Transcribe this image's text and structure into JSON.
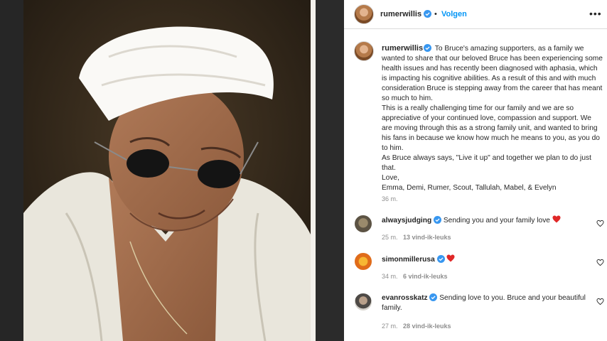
{
  "post": {
    "author": "rumerwillis",
    "follow_label": "Volgen",
    "more_label": "•••",
    "separator": "•",
    "caption_lines": [
      "To Bruce's amazing supporters, as a family we wanted to share that our beloved Bruce has been experiencing some health issues and has recently been diagnosed with aphasia, which is impacting his cognitive abilities. As a result of this and with much consideration Bruce is stepping away from the career that has meant so much to him.",
      "This is a really challenging time for our family and we are so appreciative of your continued love, compassion and support. We are moving through this as a strong family unit, and wanted to bring his fans in because we know how much he means to you, as you do to him.",
      "As Bruce always says, \"Live it up\" and together we plan to do just that.",
      "Love,",
      "Emma, Demi, Rumer, Scout, Tallulah, Mabel, & Evelyn"
    ],
    "time": "36 m."
  },
  "comments": [
    {
      "username": "alwaysjudging",
      "text": "Sending you and your family love",
      "heart": true,
      "time": "25 m.",
      "likes": "13 vind-ik-leuks"
    },
    {
      "username": "simonmillerusa",
      "text": "",
      "heart": true,
      "time": "34 m.",
      "likes": "6 vind-ik-leuks"
    },
    {
      "username": "evanrosskatz",
      "text": "Sending love to you. Bruce and your beautiful",
      "text2": "family.",
      "heart": false,
      "time": "27 m.",
      "likes": "28 vind-ik-leuks"
    }
  ],
  "colors": {
    "link": "#0095f6",
    "verified": "#3897f0",
    "heart": "#ed4956",
    "muted": "#8e8e8e"
  }
}
